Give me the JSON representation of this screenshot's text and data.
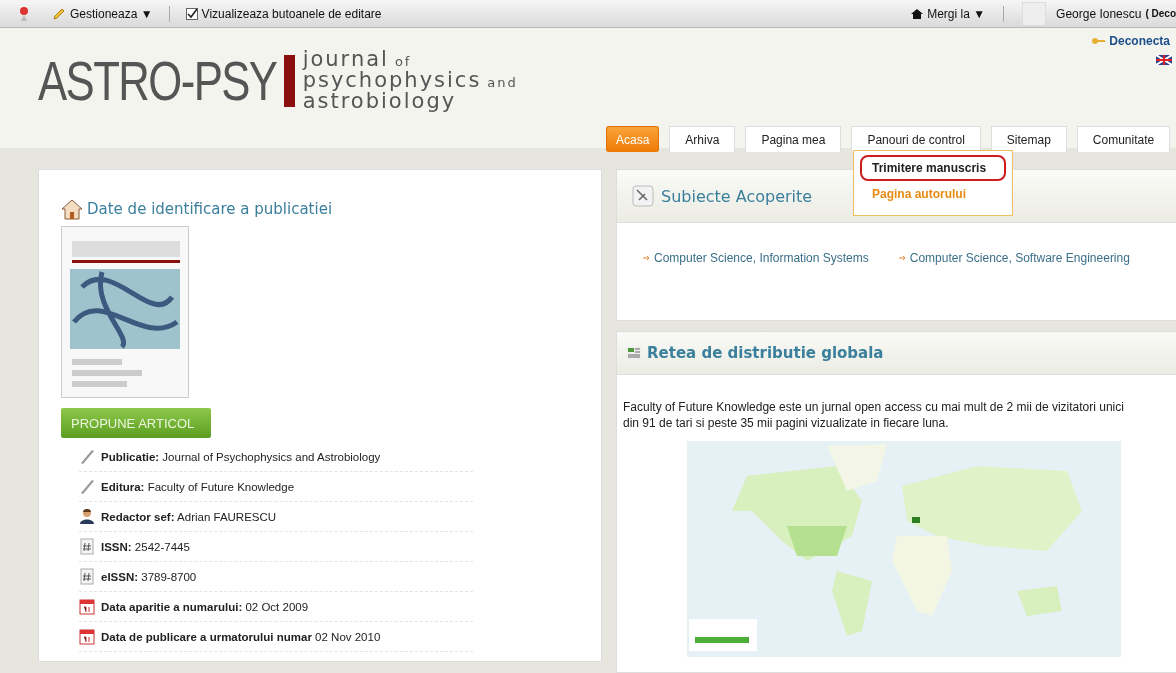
{
  "top_bar": {
    "manage_menu": "Gestioneaza ▼",
    "edit_toggle": {
      "label": "Vizualizeaza butoanele de editare",
      "checked": true
    },
    "goto_menu": "Mergi la ▼",
    "user_name": "George Ionescu",
    "logout_hint": "( Deco"
  },
  "header": {
    "logo_main": "ASTRO-PSY",
    "logo_lines": [
      {
        "text": "journal",
        "suffix": "of"
      },
      {
        "text": "psychophysics",
        "suffix": "and"
      },
      {
        "text": "astrobiology"
      }
    ],
    "logout_link": "Deconecta"
  },
  "nav_tabs": [
    {
      "label": "Acasa",
      "selected": true
    },
    {
      "label": "Arhiva",
      "selected": false
    },
    {
      "label": "Pagina mea",
      "selected": false
    },
    {
      "label": "Panouri de control",
      "selected": false
    },
    {
      "label": "Sitemap",
      "selected": false
    },
    {
      "label": "Comunitate",
      "selected": false
    }
  ],
  "dropdown": {
    "items": [
      {
        "label": "Trimitere manuscris",
        "circled": true,
        "selected": false
      },
      {
        "label": "Pagina autorului",
        "circled": false,
        "selected": true
      }
    ]
  },
  "publication_panel": {
    "title": "Date de identificare a publicatiei",
    "button": "PROPUNE ARTICOL",
    "rows": [
      {
        "kind": "pen",
        "label": "Publicatie:",
        "value": "Journal of Psychophysics and Astrobiology"
      },
      {
        "kind": "pen",
        "label": "Editura:",
        "value": "Faculty of Future Knowledge"
      },
      {
        "kind": "person",
        "label": "Redactor sef:",
        "value": "Adrian FAURESCU"
      },
      {
        "kind": "hash",
        "label": "ISSN:",
        "value": "2542-7445"
      },
      {
        "kind": "hash",
        "label": "eISSN:",
        "value": "3789-8700"
      },
      {
        "kind": "calendar",
        "label": "Data aparitie a numarului:",
        "value": "02 Oct 2009"
      },
      {
        "kind": "calendar",
        "label": "Data de publicare a urmatorului numar",
        "value": "02 Nov 2010"
      }
    ]
  },
  "subjects_panel": {
    "title": "Subiecte Acoperite",
    "links": [
      "Computer Science, Information Systems",
      "Computer Science, Software Engineering"
    ]
  },
  "distribution_panel": {
    "title": "Retea de distributie globala",
    "text": "Faculty of Future Knowledge este un jurnal open access cu mai mult de 2 mii de vizitatori unici din 91 de tari si peste 35 mii pagini vizualizate in fiecare luna."
  }
}
